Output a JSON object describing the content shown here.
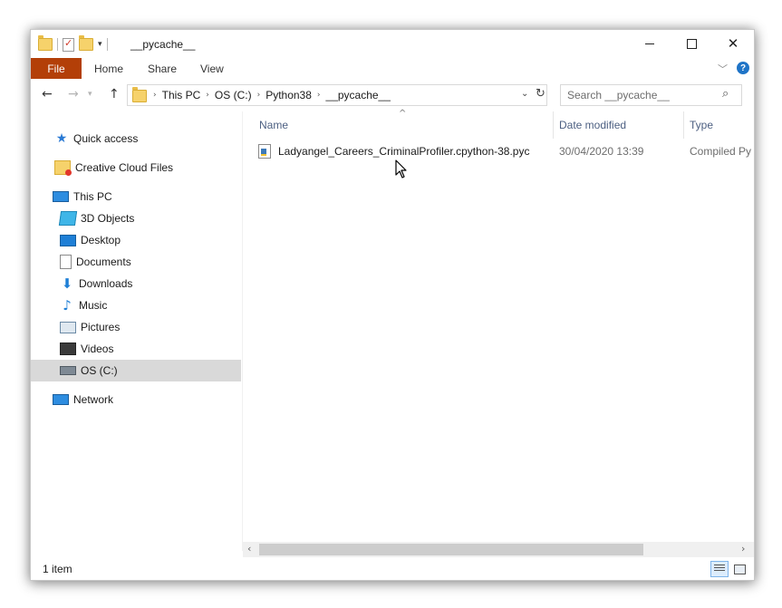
{
  "window": {
    "title": "__pycache__"
  },
  "ribbon": {
    "file": "File",
    "home": "Home",
    "share": "Share",
    "view": "View",
    "help": "?"
  },
  "address": {
    "crumbs": [
      "This PC",
      "OS (C:)",
      "Python38",
      "__pycache__"
    ]
  },
  "search": {
    "placeholder": "Search __pycache__"
  },
  "nav": {
    "quick_access": "Quick access",
    "creative_cloud": "Creative Cloud Files",
    "this_pc": "This PC",
    "items": [
      "3D Objects",
      "Desktop",
      "Documents",
      "Downloads",
      "Music",
      "Pictures",
      "Videos",
      "OS (C:)"
    ],
    "network": "Network",
    "selected": "OS (C:)"
  },
  "columns": {
    "name": "Name",
    "date": "Date modified",
    "type": "Type"
  },
  "files": [
    {
      "name": "Ladyangel_Careers_CriminalProfiler.cpython-38.pyc",
      "date": "30/04/2020 13:39",
      "type": "Compiled Py"
    }
  ],
  "status": {
    "count": "1 item"
  },
  "icons": {
    "file_menu_color": "#b33f08",
    "selection_color": "#d9d9d9",
    "column_header_color": "#4d6082"
  }
}
